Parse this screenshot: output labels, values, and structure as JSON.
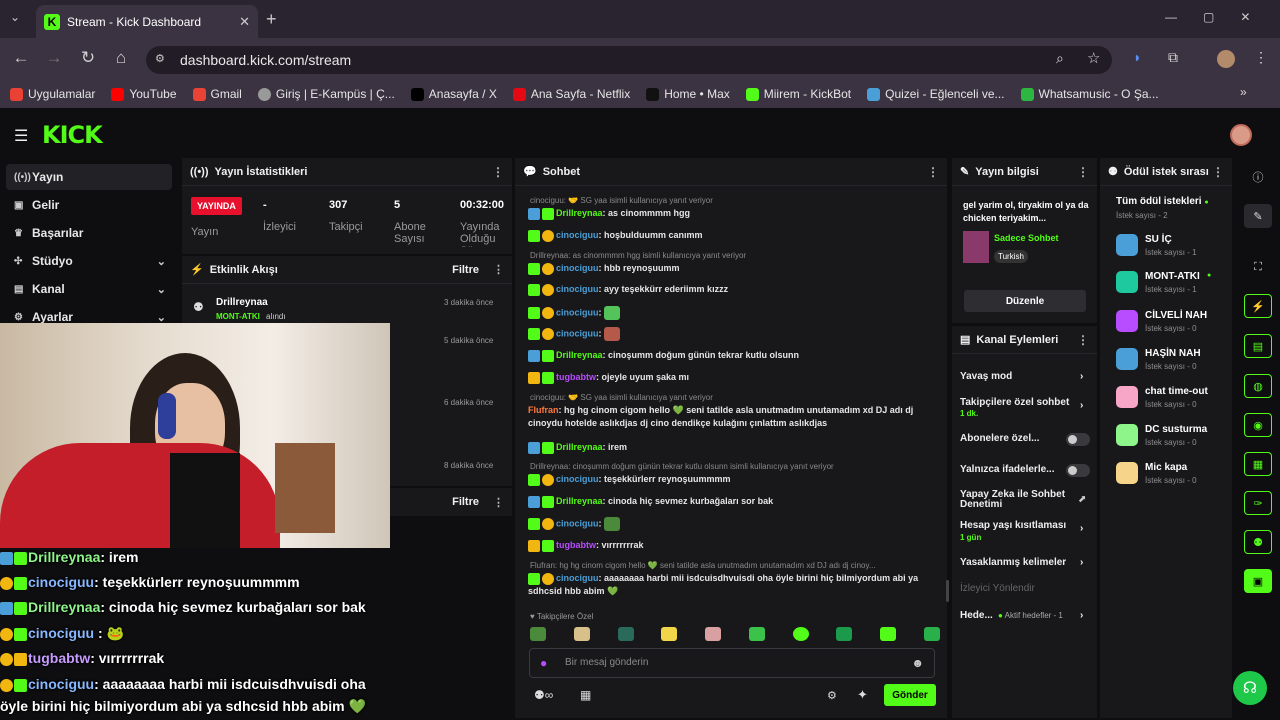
{
  "browser": {
    "tab_title": "Stream - Kick Dashboard",
    "url": "dashboard.kick.com/stream",
    "bookmarks": [
      "Uygulamalar",
      "YouTube",
      "Gmail",
      "Giriş | E-Kampüs | Ç...",
      "Anasayfa / X",
      "Ana Sayfa - Netflix",
      "Home • Max",
      "Miirem - KickBot",
      "Quizei - Eğlenceli ve...",
      "Whatsamusic - O Şa..."
    ]
  },
  "app": {
    "logo": "KICK",
    "accent": "#53fc18"
  },
  "sidebar": [
    {
      "label": "Yayın",
      "icon": "broadcast-icon"
    },
    {
      "label": "Gelir",
      "icon": "revenue-icon"
    },
    {
      "label": "Başarılar",
      "icon": "trophy-icon"
    },
    {
      "label": "Stüdyo",
      "icon": "studio-icon"
    },
    {
      "label": "Kanal",
      "icon": "channel-icon"
    },
    {
      "label": "Ayarlar",
      "icon": "gear-icon"
    }
  ],
  "stats": {
    "title": "Yayın İstatistikleri",
    "live": "YAYINDA",
    "items": [
      {
        "label": "Yayın",
        "value": ""
      },
      {
        "label": "İzleyici",
        "value": "-"
      },
      {
        "label": "Takipçi",
        "value": "307"
      },
      {
        "label": "Abone Sayısı",
        "value": "5"
      },
      {
        "label": "Yayında Olduğu Süre",
        "value": "00:32:00"
      }
    ]
  },
  "activity": {
    "title": "Etkinlik Akışı",
    "filter": "Filtre",
    "items": [
      {
        "user": "Drillreynaa",
        "detail": "MONT-ATKI",
        "detail2": "alındı",
        "time": "3 dakika önce"
      },
      {
        "time": "5 dakika önce"
      },
      {
        "time": "6 dakika önce"
      },
      {
        "time": "8 dakika önce"
      }
    ],
    "filter2": "Filtre"
  },
  "chat": {
    "title": "Sohbet",
    "lines": [
      {
        "type": "reply",
        "text": "cinociguu: 🤝 SG yaa isimli kullanıcıya yanıt veriyor"
      },
      {
        "user": "Drillreynaa",
        "color": "#53fc18",
        "msg": ": as cinommmm hgg"
      },
      {
        "user": "cinociguu",
        "color": "#4a9fd8",
        "msg": ": hoşbulduumm canımm"
      },
      {
        "type": "reply",
        "text": "Drillreynaa: as cinommmm hgg isimli kullanıcıya yanıt veriyor"
      },
      {
        "user": "cinociguu",
        "color": "#4a9fd8",
        "msg": ": hbb reynoşuumm"
      },
      {
        "user": "cinociguu",
        "color": "#4a9fd8",
        "msg": ": ayy teşekkürr ederiimm kızzz"
      },
      {
        "user": "cinociguu",
        "color": "#4a9fd8",
        "msg": ":"
      },
      {
        "user": "cinociguu",
        "color": "#4a9fd8",
        "msg": ":"
      },
      {
        "user": "Drillreynaa",
        "color": "#53fc18",
        "msg": ": cinoşumm doğum günün tekrar kutlu olsunn"
      },
      {
        "user": "tugbabtw",
        "color": "#b84cff",
        "msg": ": ojeyle uyum şaka mı"
      },
      {
        "type": "reply",
        "text": "cinociguu: 🤝 SG yaa isimli kullanıcıya yanıt veriyor"
      },
      {
        "user": "Flufran",
        "color": "#ff7a3d",
        "msg": ": hg hg cinom cigom hello 💚 seni tatilde asla unutmadım unutamadım xd DJ adı dj cinoydu hotelde aslıkdjas dj cino dendikçe kulağını çınlattım aslıkdjas"
      },
      {
        "user": "Drillreynaa",
        "color": "#53fc18",
        "msg": ": irem"
      },
      {
        "type": "reply",
        "text": "Drillreynaa: cinoşumm doğum günün tekrar kutlu olsunn isimli kullanıcıya yanıt veriyor"
      },
      {
        "user": "cinociguu",
        "color": "#4a9fd8",
        "msg": ": teşekkürlerr reynoşuummmm"
      },
      {
        "user": "Drillreynaa",
        "color": "#53fc18",
        "msg": ": cinoda hiç sevmez kurbağaları sor bak"
      },
      {
        "user": "cinociguu",
        "color": "#4a9fd8",
        "msg": ":"
      },
      {
        "user": "tugbabtw",
        "color": "#b84cff",
        "msg": ": vırrrrrrrak"
      },
      {
        "type": "reply",
        "text": "Flufran: hg hg cinom cigom hello 💚 seni tatilde asla unutmadım unutamadım xd DJ adı dj cinoy..."
      },
      {
        "user": "cinociguu",
        "color": "#4a9fd8",
        "msg": ": aaaaaaaa harbi mii isdcuisdhvuisdi oha öyle birini hiç bilmiyordum abi ya sdhcsid hbb abim 💚"
      }
    ],
    "followers_only": "Takipçilere Özel",
    "placeholder": "Bir mesaj gönderin",
    "send": "Gönder"
  },
  "stream_info": {
    "title": "Yayın bilgisi",
    "text": "gel yarim ol, tiryakim ol ya da chicken teriyakim...",
    "category": "Sadece Sohbet",
    "lang": "Turkish",
    "edit": "Düzenle"
  },
  "channel_actions": {
    "title": "Kanal Eylemleri",
    "items": [
      "Yavaş mod",
      "Takipçilere özel sohbet",
      "Abonelere özel...",
      "Yalnızca ifadelerle...",
      "Yapay Zeka ile Sohbet Denetimi",
      "Hesap yaşı kısıtlaması",
      "Yasaklanmış kelimeler",
      "İzleyici Yönlendir",
      "Hede..."
    ],
    "sub1": "1 dk.",
    "sub2": "1 gün",
    "goal": "Aktif hedefler - 1"
  },
  "rewards": {
    "title": "Ödül istek sırası",
    "all": "Tüm ödül istekleri",
    "all_count": "İstek sayısı - 2",
    "items": [
      {
        "name": "SU İÇ",
        "count": "İstek sayısı - 1",
        "color": "#4a9fd8"
      },
      {
        "name": "MONT-ATKI",
        "count": "İstek sayısı - 1",
        "color": "#1ec9a0"
      },
      {
        "name": "CİLVELİ NAH",
        "count": "İstek sayısı - 0",
        "color": "#b84cff"
      },
      {
        "name": "HAŞİN NAH",
        "count": "İstek sayısı - 0",
        "color": "#4a9fd8"
      },
      {
        "name": "chat time-out",
        "count": "İstek sayısı - 0",
        "color": "#f7a6c8"
      },
      {
        "name": "DC susturma",
        "count": "İstek sayısı - 0",
        "color": "#8ef58a"
      },
      {
        "name": "Mic kapa",
        "count": "İstek sayısı - 0",
        "color": "#f6d58a"
      }
    ]
  },
  "overlay_chat": [
    {
      "user": "Drillreynaa",
      "color": "#8ef58a",
      "msg": ": irem"
    },
    {
      "user": "cinociguu",
      "color": "#88b8ff",
      "msg": ": teşekkürlerr reynoşuummmm"
    },
    {
      "user": "Drillreynaa",
      "color": "#8ef58a",
      "msg": ": cinoda hiç sevmez kurbağaları sor bak"
    },
    {
      "user": "cinociguu",
      "color": "#88b8ff",
      "msg": " : 🐸"
    },
    {
      "user": "tugbabtw",
      "color": "#c79cff",
      "msg": ": vırrrrrrrak"
    },
    {
      "user": "cinociguu",
      "color": "#88b8ff",
      "msg": ": aaaaaaaa harbi mii isdcuisdhvuisdi oha"
    },
    {
      "user": "",
      "color": "#fff",
      "msg": "öyle birini hiç bilmiyordum abi ya sdhcsid hbb abim 💚"
    }
  ]
}
